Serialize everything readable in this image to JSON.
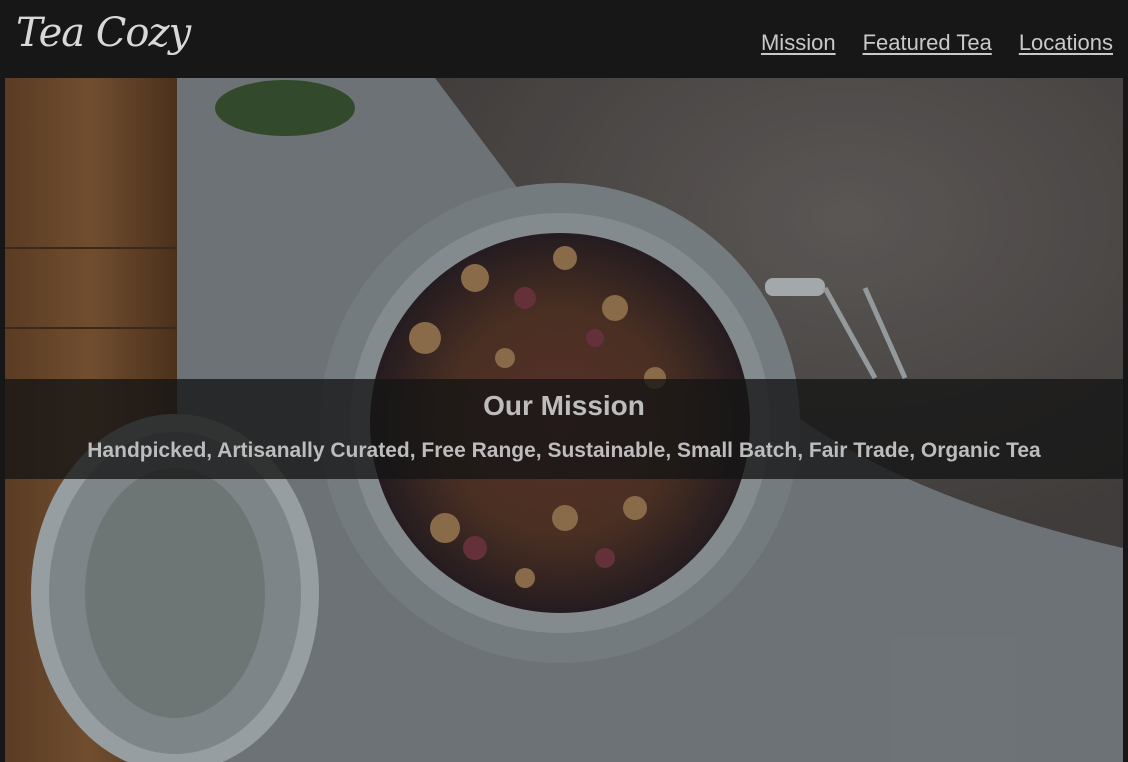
{
  "header": {
    "logo_text": "Tea Cozy",
    "nav": [
      {
        "label": "Mission"
      },
      {
        "label": "Featured Tea"
      },
      {
        "label": "Locations"
      }
    ]
  },
  "hero": {
    "image_description_icon": "tea-jar-photo",
    "title": "Our Mission",
    "subtitle": "Handpicked, Artisanally Curated, Free Range, Sustainable, Small Batch, Fair Trade, Organic Tea"
  }
}
